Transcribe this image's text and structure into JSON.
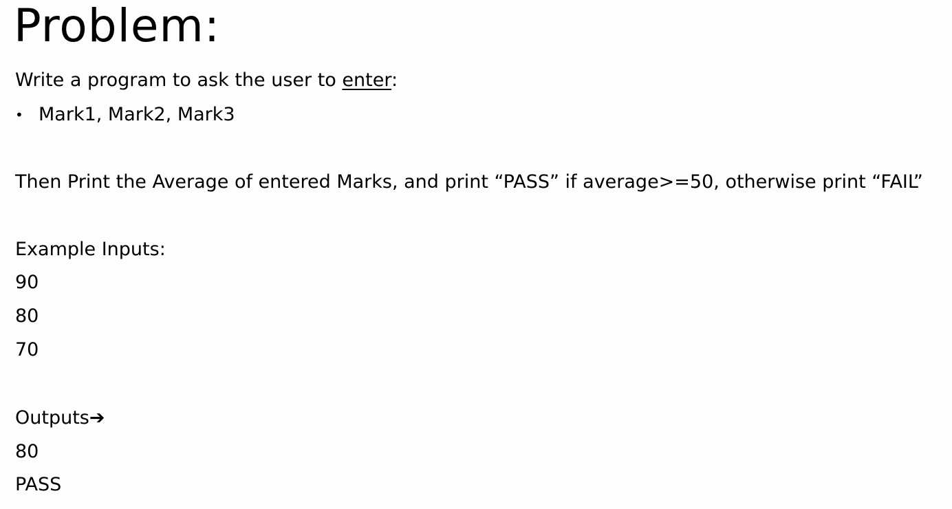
{
  "title": "Problem:",
  "intro": {
    "prefix": "Write a program to ask the user to ",
    "underlined": "enter",
    "suffix": ":"
  },
  "bullets": [
    {
      "glyph": "•",
      "text": "Mark1, Mark2, Mark3"
    }
  ],
  "instruction": "Then Print the Average of entered Marks, and print “PASS” if average>=50, otherwise print “FAIL”",
  "example": {
    "heading": "Example Inputs:",
    "inputs": [
      "90",
      "80",
      "70"
    ]
  },
  "outputs": {
    "heading": "Outputs",
    "arrow": "➔",
    "values": [
      "80",
      "PASS"
    ]
  }
}
